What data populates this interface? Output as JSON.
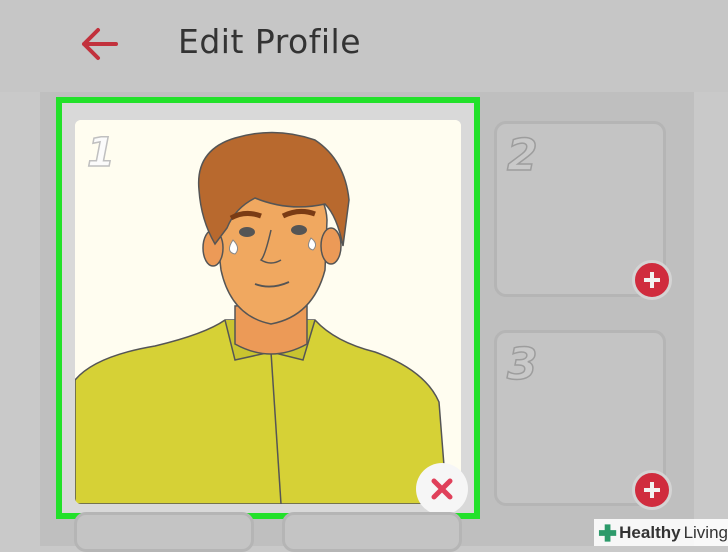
{
  "header": {
    "title": "Edit Profile",
    "back_icon": "arrow-left-icon",
    "accent_color": "#c2313c"
  },
  "photos": [
    {
      "number": "1",
      "state": "filled",
      "action_icon": "close-icon"
    },
    {
      "number": "2",
      "state": "empty",
      "action_icon": "plus-icon"
    },
    {
      "number": "3",
      "state": "empty",
      "action_icon": "plus-icon"
    }
  ],
  "highlight_color": "#22e12a",
  "watermark": {
    "word1": "Healthy",
    "word2": "Living"
  }
}
